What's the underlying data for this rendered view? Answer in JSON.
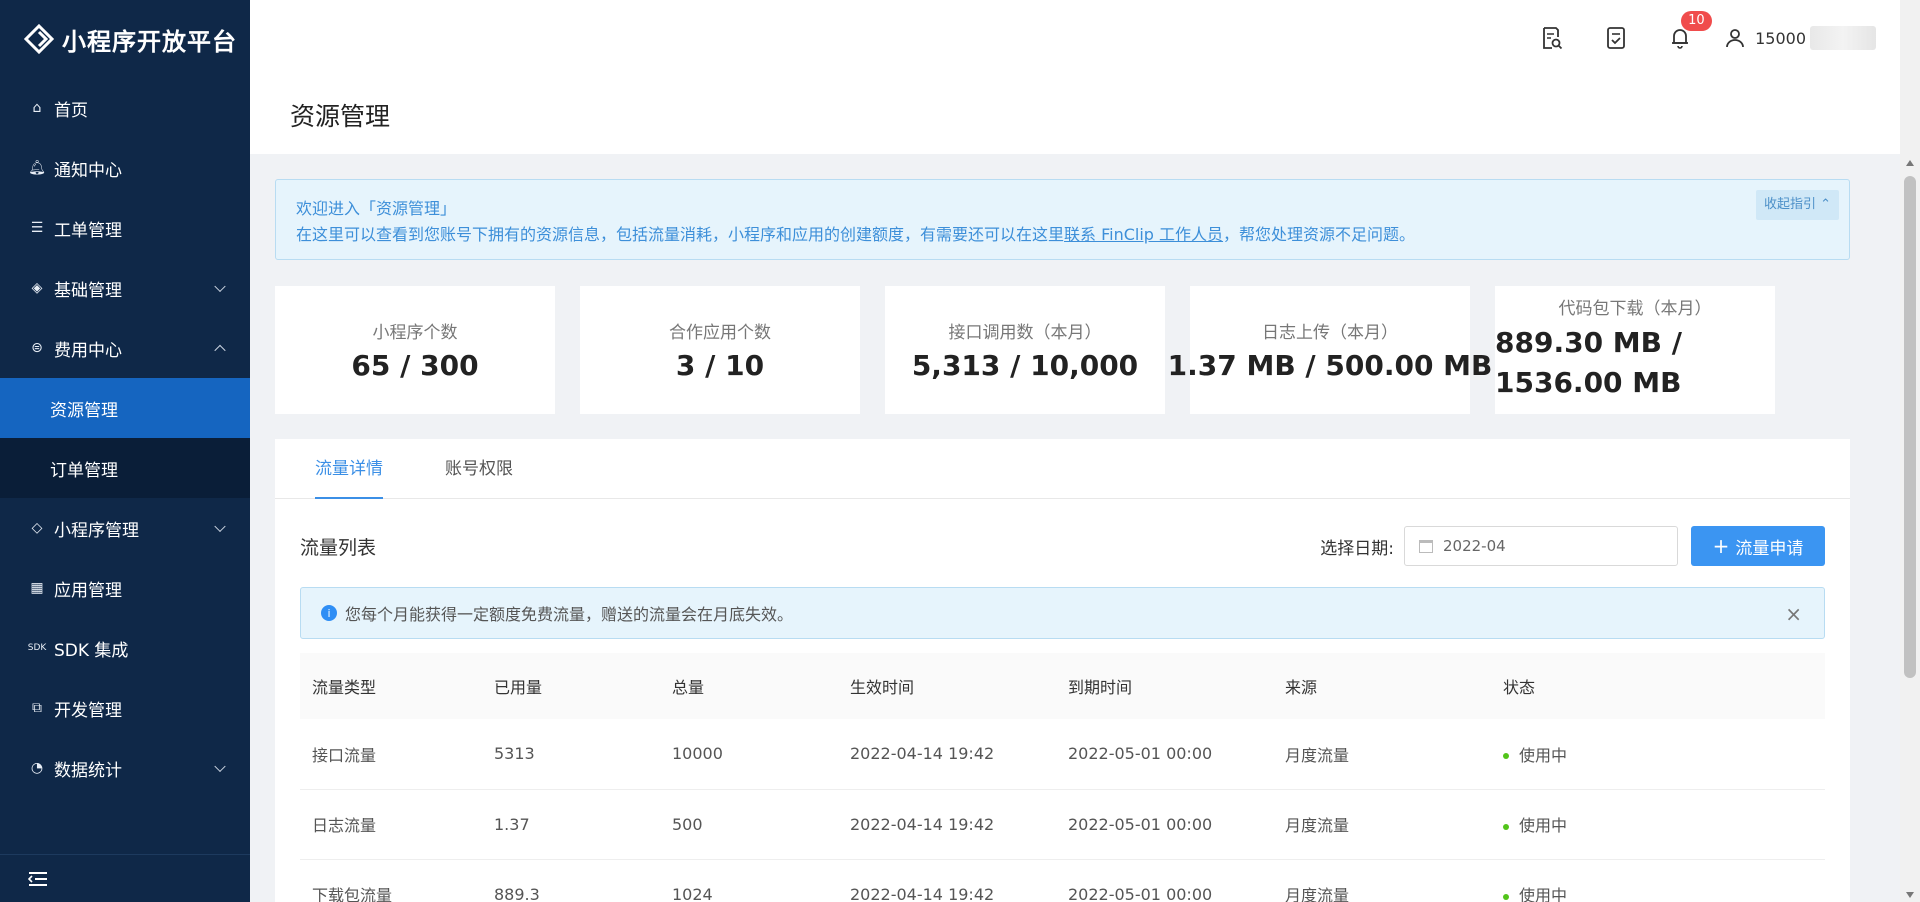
{
  "app": {
    "title": "小程序开放平台"
  },
  "sidebar": {
    "items": [
      {
        "label": "首页",
        "icon": "home-icon"
      },
      {
        "label": "通知中心",
        "icon": "bell-icon"
      },
      {
        "label": "工单管理",
        "icon": "document-icon"
      },
      {
        "label": "基础管理",
        "icon": "layers-icon"
      },
      {
        "label": "费用中心",
        "icon": "currency-icon"
      },
      {
        "label": "资源管理"
      },
      {
        "label": "订单管理"
      },
      {
        "label": "小程序管理",
        "icon": "diamond-icon"
      },
      {
        "label": "应用管理",
        "icon": "grid-icon"
      },
      {
        "label": "SDK 集成",
        "icon": "sdk-icon"
      },
      {
        "label": "开发管理",
        "icon": "code-icon"
      },
      {
        "label": "数据统计",
        "icon": "pie-icon"
      }
    ]
  },
  "topbar": {
    "badge": "10",
    "user": "15000"
  },
  "page": {
    "title": "资源管理"
  },
  "guide": {
    "title": "欢迎进入「资源管理」",
    "text_before": "在这里可以查看到您账号下拥有的资源信息，包括流量消耗，小程序和应用的创建额度，有需要还可以在这里",
    "link": "联系 FinClip 工作人员",
    "text_after": "，帮您处理资源不足问题。",
    "collapse": "收起指引"
  },
  "stats": [
    {
      "label": "小程序个数",
      "value": "65 / 300"
    },
    {
      "label": "合作应用个数",
      "value": "3 / 10"
    },
    {
      "label": "接口调用数（本月）",
      "value": "5,313 / 10,000"
    },
    {
      "label": "日志上传（本月）",
      "value": "1.37 MB / 500.00 MB"
    },
    {
      "label": "代码包下载（本月）",
      "value": "889.30 MB / 1536.00 MB"
    }
  ],
  "tabs": [
    {
      "label": "流量详情"
    },
    {
      "label": "账号权限"
    }
  ],
  "list": {
    "title": "流量列表",
    "date_label": "选择日期:",
    "date_value": "2022-04",
    "apply_button": "流量申请",
    "info": "您每个月能获得一定额度免费流量，赠送的流量会在月底失效。"
  },
  "table": {
    "headers": [
      "流量类型",
      "已用量",
      "总量",
      "生效时间",
      "到期时间",
      "来源",
      "状态"
    ],
    "rows": [
      [
        "接口流量",
        "5313",
        "10000",
        "2022-04-14 19:42",
        "2022-05-01 00:00",
        "月度流量",
        "使用中"
      ],
      [
        "日志流量",
        "1.37",
        "500",
        "2022-04-14 19:42",
        "2022-05-01 00:00",
        "月度流量",
        "使用中"
      ],
      [
        "下载包流量",
        "889.3",
        "1024",
        "2022-04-14 19:42",
        "2022-05-01 00:00",
        "月度流量",
        "使用中"
      ]
    ]
  },
  "colors": {
    "sidebar_bg": "#0f2848",
    "active": "#1565c0",
    "primary": "#3b95f2",
    "status": "#52c41a"
  }
}
